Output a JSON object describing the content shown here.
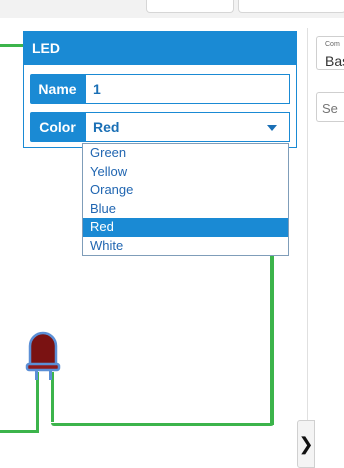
{
  "inspector": {
    "title": "LED",
    "name_label": "Name",
    "name_value": "1",
    "color_label": "Color",
    "color_value": "Red"
  },
  "color_options": [
    "Green",
    "Yellow",
    "Orange",
    "Blue",
    "Red",
    "White"
  ],
  "selected_color": "Red",
  "sidepanel": {
    "components_label": "Com",
    "components_value": "Bas",
    "search_placeholder": "Se"
  },
  "collapse_button": "❯",
  "colors": {
    "accent": "#1a8ad4",
    "wire": "#3cb44b",
    "led_body": "#7a1212",
    "led_outline": "#5b8fd6"
  },
  "icons": [
    "chevron-down-icon",
    "chevron-right-icon",
    "led-component-icon"
  ]
}
